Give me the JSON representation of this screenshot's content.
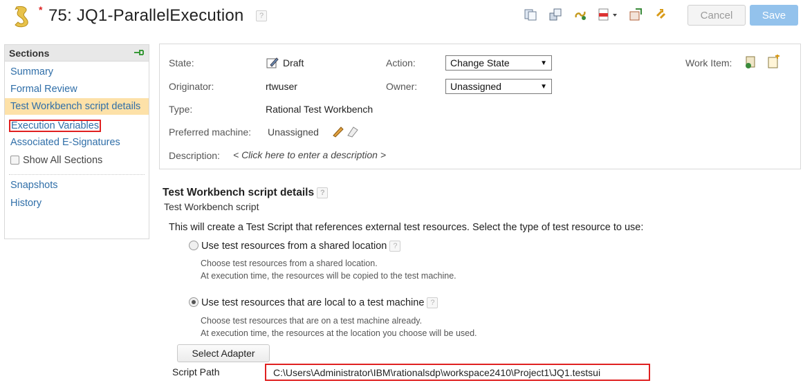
{
  "header": {
    "dirty_marker": "*",
    "title": "75: JQ1-ParallelExecution",
    "help": "?",
    "cancel_label": "Cancel",
    "save_label": "Save",
    "toolbar_icons": [
      "copy-icon",
      "duplicate-icon",
      "link-icon",
      "pdf-icon",
      "dropdown-arrow-icon",
      "export-icon",
      "refresh-icon"
    ]
  },
  "sidebar": {
    "title": "Sections",
    "items": [
      {
        "label": "Summary"
      },
      {
        "label": "Formal Review"
      },
      {
        "label": "Test Workbench script details"
      },
      {
        "label": "Execution Variables"
      },
      {
        "label": "Associated E-Signatures"
      }
    ],
    "show_all_label": "Show All Sections",
    "extra_items": [
      {
        "label": "Snapshots"
      },
      {
        "label": "History"
      }
    ]
  },
  "details": {
    "state_label": "State:",
    "state_value": "Draft",
    "action_label": "Action:",
    "action_value": "Change State",
    "work_item_label": "Work Item:",
    "originator_label": "Originator:",
    "originator_value": "rtwuser",
    "owner_label": "Owner:",
    "owner_value": "Unassigned",
    "type_label": "Type:",
    "type_value": "Rational Test Workbench",
    "preferred_label": "Preferred machine:",
    "preferred_value": "Unassigned",
    "description_label": "Description:",
    "description_value": "< Click here to enter a description >"
  },
  "script_section": {
    "title": "Test Workbench script details",
    "subtitle": "Test Workbench script",
    "intro": "This will create a Test Script that references external test resources. Select the type of test resource to use:",
    "option1_label": "Use test resources from a shared location",
    "option1_desc1": "Choose test resources from a shared location.",
    "option1_desc2": "At execution time, the resources will be copied to the test machine.",
    "option2_label": "Use test resources that are local to a test machine",
    "option2_desc1": "Choose test resources that are on a test machine already.",
    "option2_desc2": "At execution time, the resources at the location you choose will be used.",
    "selected_option": 2,
    "select_adapter_label": "Select Adapter",
    "script_path_label": "Script Path",
    "script_path_value": "C:\\Users\\Administrator\\IBM\\rationalsdp\\workspace2410\\Project1\\JQ1.testsui"
  },
  "colors": {
    "link": "#2f6ea8",
    "active_section": "#fde1a8",
    "highlight_box": "#e02020",
    "save_button": "#93c2ec"
  }
}
